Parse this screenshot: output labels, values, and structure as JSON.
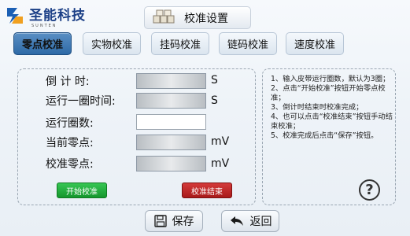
{
  "header": {
    "brand_name": "圣能科技",
    "brand_sub": "SUNTEN",
    "title": "校准设置"
  },
  "tabs": [
    {
      "label": "零点校准",
      "active": true
    },
    {
      "label": "实物校准",
      "active": false
    },
    {
      "label": "挂码校准",
      "active": false
    },
    {
      "label": "链码校准",
      "active": false
    },
    {
      "label": "速度校准",
      "active": false
    }
  ],
  "fields": {
    "countdown": {
      "label": "倒 计 时:",
      "value": "",
      "unit": "S"
    },
    "lap_time": {
      "label": "运行一圈时间:",
      "value": "",
      "unit": "S"
    },
    "laps": {
      "label": "运行圈数:",
      "value": ""
    },
    "current_zero": {
      "label": "当前零点:",
      "value": "",
      "unit": "mV"
    },
    "calib_zero": {
      "label": "校准零点:",
      "value": "",
      "unit": "mV"
    }
  },
  "buttons": {
    "start": "开始校准",
    "end": "校准结束",
    "save": "保存",
    "back": "返回"
  },
  "instructions": [
    "1、输入皮带运行圈数，默认为3圈；",
    "2、点击“开始校准”按钮开始零点校准；",
    "3、倒计时结束时校准完成；",
    "4、也可以点击“校准结束”按钮手动结束校准；",
    "5、校准完成后点击“保存”按钮。"
  ],
  "colors": {
    "active_tab": "#2e6aa6",
    "start_button": "#14962d",
    "end_button": "#a81a1a",
    "brand": "#1b3f86"
  },
  "icons": [
    "brand-logo-icon",
    "settings-icon",
    "save-icon",
    "back-icon",
    "help-icon"
  ]
}
